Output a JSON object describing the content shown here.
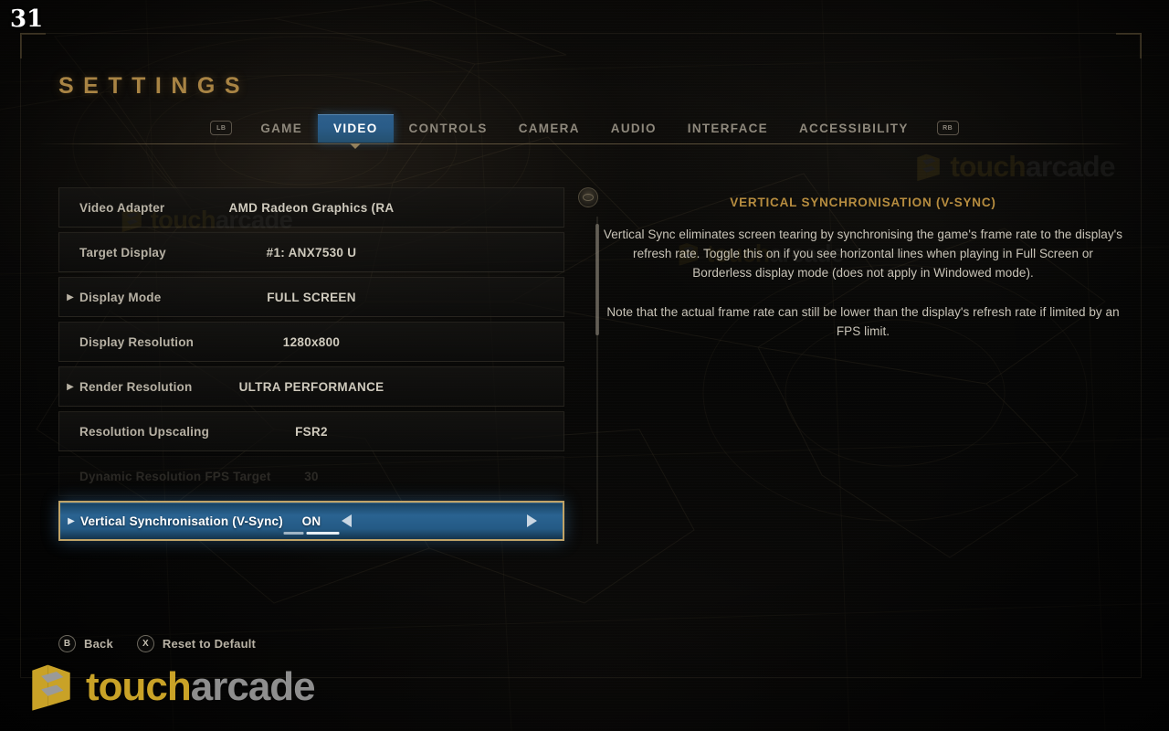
{
  "overlay": {
    "fps": "31"
  },
  "header": {
    "title": "SETTINGS",
    "left_bumper": "LB",
    "right_bumper": "RB",
    "tabs": [
      {
        "label": "GAME",
        "active": false
      },
      {
        "label": "VIDEO",
        "active": true
      },
      {
        "label": "CONTROLS",
        "active": false
      },
      {
        "label": "CAMERA",
        "active": false
      },
      {
        "label": "AUDIO",
        "active": false
      },
      {
        "label": "INTERFACE",
        "active": false
      },
      {
        "label": "ACCESSIBILITY",
        "active": false
      }
    ]
  },
  "settings": {
    "rows": [
      {
        "label": "Video Adapter",
        "value": "AMD Radeon Graphics (RA",
        "expandable": false,
        "disabled": false,
        "selected": false
      },
      {
        "label": "Target Display",
        "value": "#1: ANX7530 U",
        "expandable": false,
        "disabled": false,
        "selected": false
      },
      {
        "label": "Display Mode",
        "value": "FULL SCREEN",
        "expandable": true,
        "disabled": false,
        "selected": false
      },
      {
        "label": "Display Resolution",
        "value": "1280x800",
        "expandable": false,
        "disabled": false,
        "selected": false
      },
      {
        "label": "Render Resolution",
        "value": "ULTRA PERFORMANCE",
        "expandable": true,
        "disabled": false,
        "selected": false
      },
      {
        "label": "Resolution Upscaling",
        "value": "FSR2",
        "expandable": false,
        "disabled": false,
        "selected": false
      },
      {
        "label": "Dynamic Resolution FPS Target",
        "value": "30",
        "expandable": false,
        "disabled": true,
        "selected": false
      },
      {
        "label": "Vertical Synchronisation (V-Sync)",
        "value": "ON",
        "expandable": true,
        "disabled": false,
        "selected": true
      }
    ],
    "scroll_stick_icon": "analog-stick-icon"
  },
  "description": {
    "title": "VERTICAL SYNCHRONISATION (V-SYNC)",
    "paragraphs": [
      "Vertical Sync eliminates screen tearing by synchronising the game's frame rate to the display's refresh rate. Toggle this on if you see horizontal lines when playing in Full Screen or Borderless display mode (does not apply in Windowed mode).",
      "Note that the actual frame rate can still be lower than the display's refresh rate if limited by an FPS limit."
    ]
  },
  "hints": [
    {
      "glyph": "B",
      "label": "Back"
    },
    {
      "glyph": "X",
      "label": "Reset to Default"
    }
  ],
  "watermark": {
    "text_gold": "touch",
    "text_gray": "arcade"
  },
  "colors": {
    "accent_gold": "#a98444",
    "selection_blue": "#2a6391",
    "selection_border": "#c0a367",
    "desc_title": "#b68c3f",
    "text_primary": "#c9c4b8",
    "text_muted": "#8e887c"
  }
}
